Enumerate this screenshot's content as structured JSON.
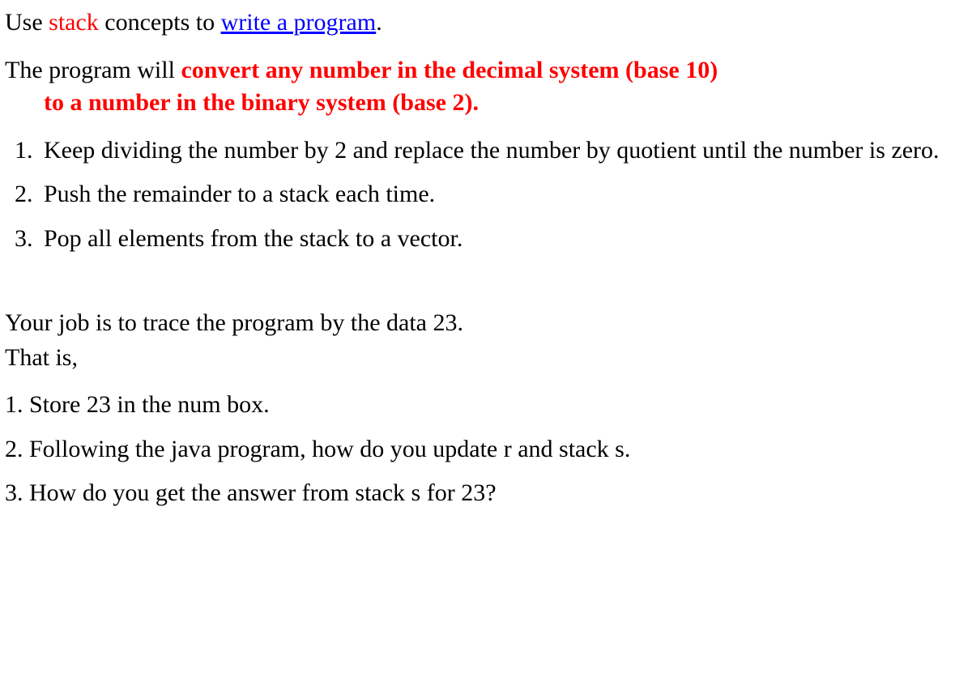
{
  "para1": {
    "t1": "Use ",
    "t2": "stack",
    "t3": " concepts to ",
    "t4": "write a program",
    "t5": "."
  },
  "para2": {
    "t1": "The program will ",
    "t2": "convert any number in the decimal system (base 10)",
    "t3": "to a number in the binary system (base 2)."
  },
  "list1": {
    "i1": "Keep dividing the number by 2 and replace the number by quotient until the number is zero.",
    "i2": "Push the remainder to a stack each time.",
    "i3": "Pop all elements from the stack to a vector."
  },
  "section2": {
    "line1": "Your job is to trace the program by the data 23.",
    "line2": "That is,"
  },
  "list2": {
    "i1": "1. Store 23 in the num box.",
    "i2": "2. Following the java program, how do you update r and stack s.",
    "i3": "3. How do you get the answer from stack s for 23?"
  }
}
